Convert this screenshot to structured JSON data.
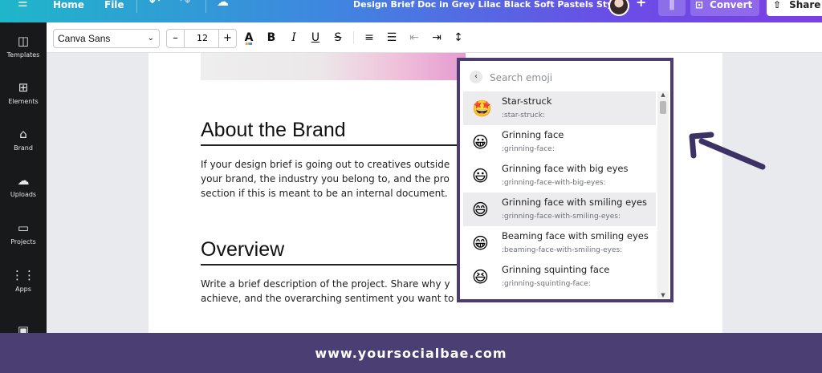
{
  "topbar": {
    "menu_icon": "hamburger-icon",
    "home": "Home",
    "file": "File",
    "undo_icon": "undo-icon",
    "redo_icon": "redo-icon",
    "cloud_icon": "cloud-saved-icon",
    "title": "Design Brief Doc in Grey Lilac Black Soft Pastels Style",
    "add_icon": "plus-icon",
    "insights_icon": "bar-chart-icon",
    "convert": "Convert",
    "share": "Share"
  },
  "sidebar": {
    "items": [
      {
        "label": "Templates",
        "icon": "templates-icon",
        "glyph": "◫"
      },
      {
        "label": "Elements",
        "icon": "elements-icon",
        "glyph": "⊞"
      },
      {
        "label": "Brand",
        "icon": "brand-icon",
        "glyph": "⌂"
      },
      {
        "label": "Uploads",
        "icon": "upload-cloud-icon",
        "glyph": "☁"
      },
      {
        "label": "Projects",
        "icon": "folder-icon",
        "glyph": "▭"
      },
      {
        "label": "Apps",
        "icon": "apps-grid-icon",
        "glyph": "⋮⋮"
      }
    ]
  },
  "format_toolbar": {
    "font": "Canva Sans",
    "font_size": "12",
    "minus": "–",
    "plus": "+"
  },
  "document": {
    "sections": [
      {
        "heading": "About the Brand",
        "lines": [
          "If your design brief is going out to creatives outside",
          "your brand, the industry you belong to, and the pro",
          "section if this is meant to be an internal document."
        ]
      },
      {
        "heading": "Overview",
        "lines": [
          "Write a brief description of the project. Share why y",
          "achieve, and the overarching sentiment you want to"
        ]
      }
    ]
  },
  "emoji_panel": {
    "search_placeholder": "Search emoji",
    "items": [
      {
        "emoji": "🤩",
        "name": "Star-struck",
        "code": ":star-struck:",
        "highlighted": true
      },
      {
        "emoji": "😀",
        "name": "Grinning face",
        "code": ":grinning-face:",
        "highlighted": false
      },
      {
        "emoji": "😃",
        "name": "Grinning face with big eyes",
        "code": ":grinning-face-with-big-eyes:",
        "highlighted": false
      },
      {
        "emoji": "😄",
        "name": "Grinning face with smiling eyes",
        "code": ":grinning-face-with-smiling-eyes:",
        "highlighted": true
      },
      {
        "emoji": "😁",
        "name": "Beaming face with smiling eyes",
        "code": ":beaming-face-with-smiling-eyes:",
        "highlighted": false
      },
      {
        "emoji": "😆",
        "name": "Grinning squinting face",
        "code": ":grinning-squinting-face:",
        "highlighted": false
      }
    ]
  },
  "footer": {
    "text": "www.yoursocialbae.com"
  },
  "colors": {
    "panel_border": "#4c3c72",
    "footer_bg": "#4b3e72",
    "arrow": "#3d3266"
  }
}
